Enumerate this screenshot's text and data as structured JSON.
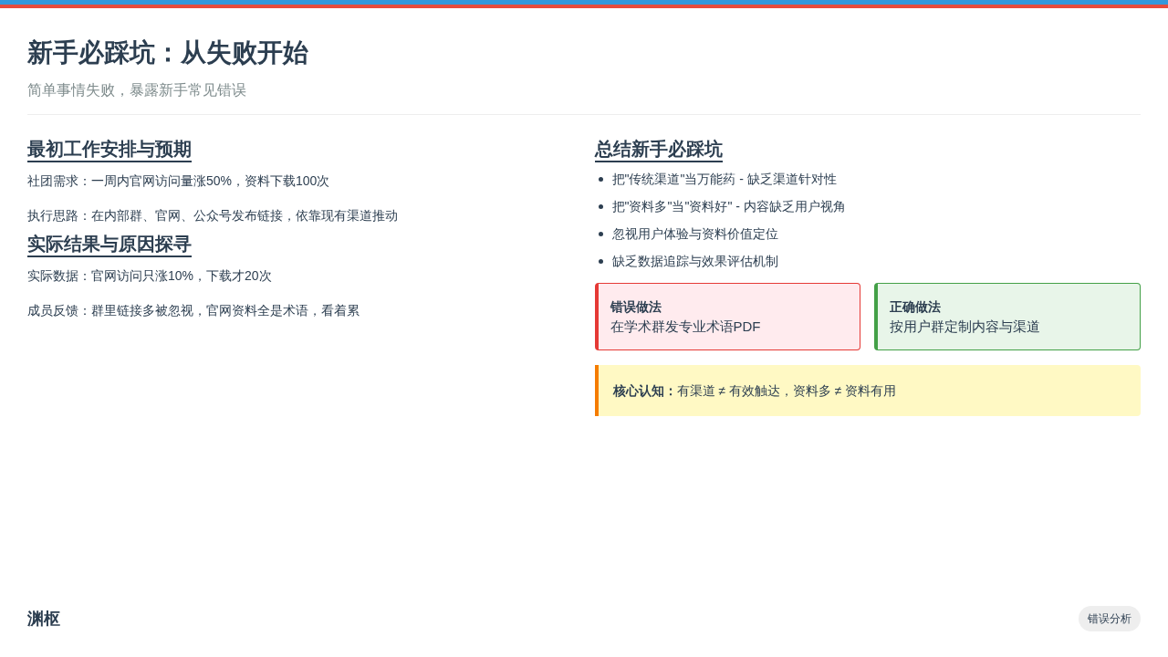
{
  "title": "新手必踩坑：从失败开始",
  "subtitle": "简单事情失败，暴露新手常见错误",
  "left_sections": [
    {
      "heading": "最初工作安排与预期",
      "lines": [
        "社团需求：一周内官网访问量涨50%，资料下载100次",
        "执行思路：在内部群、官网、公众号发布链接，依靠现有渠道推动"
      ]
    },
    {
      "heading": "实际结果与原因探寻",
      "lines": [
        "实际数据：官网访问只涨10%，下载才20次",
        "成员反馈：群里链接多被忽视，官网资料全是术语，看着累"
      ]
    }
  ],
  "summary": {
    "heading": "总结新手必踩坑",
    "bullets": [
      "把\"传统渠道\"当万能药 - 缺乏渠道针对性",
      "把\"资料多\"当\"资料好\" - 内容缺乏用户视角",
      "忽视用户体验与资料价值定位",
      "缺乏数据追踪与效果评估机制"
    ]
  },
  "comparison": [
    {
      "kind": "wrong",
      "title": "错误做法",
      "text": "在学术群发专业术语PDF"
    },
    {
      "kind": "right",
      "title": "正确做法",
      "text": "按用户群定制内容与渠道"
    }
  ],
  "key_insight": "**核心认知：**有渠道 ≠ 有效触达，资料多 ≠ 资料有用",
  "footer": {
    "brand": "渊枢",
    "tag": "错误分析"
  }
}
